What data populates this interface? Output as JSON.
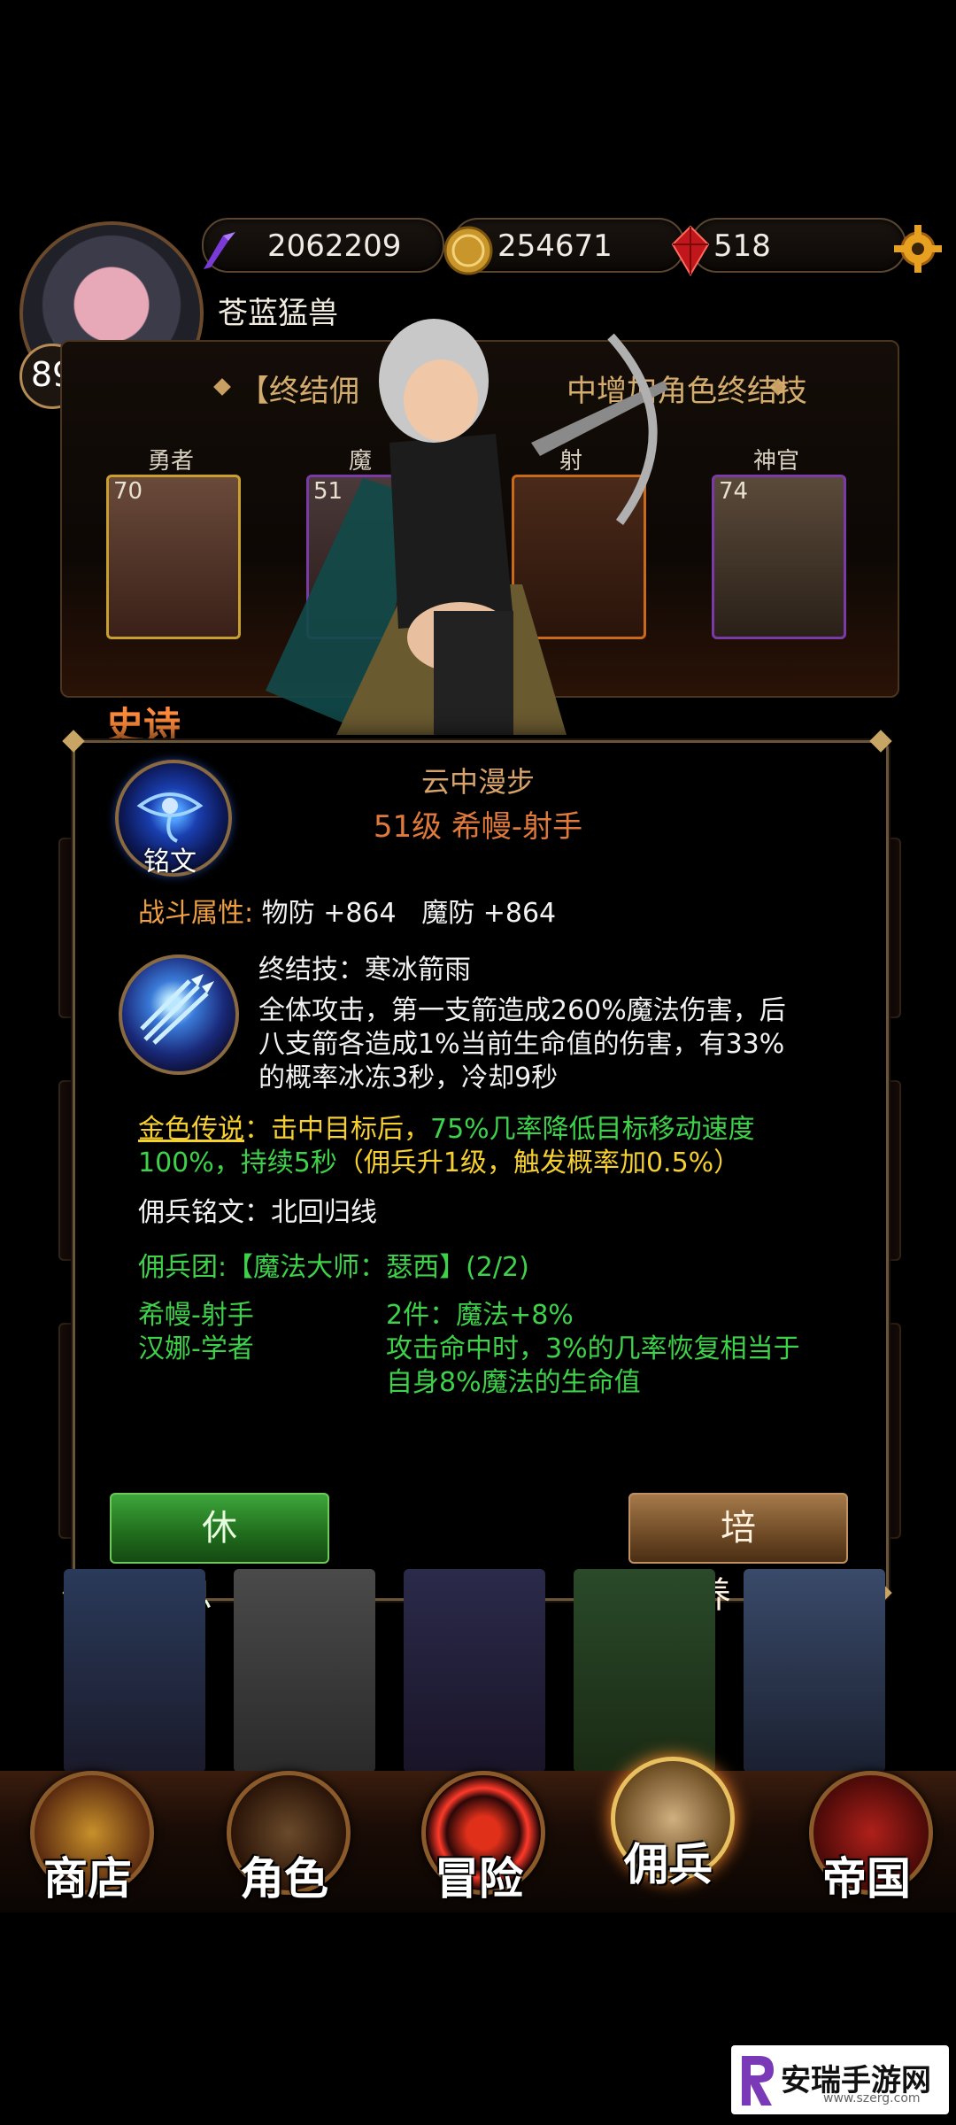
{
  "resources": {
    "soul": "2062209",
    "gold": "254671",
    "gems": "518"
  },
  "player": {
    "level": "89",
    "name": "苍蓝猛兽"
  },
  "formation": {
    "banner_left": "【终结佣",
    "banner_right": "中增加角色终结技",
    "slots": [
      {
        "class": "勇者",
        "level": "70"
      },
      {
        "class": "魔",
        "level": "51"
      },
      {
        "class": "射",
        "level": ""
      },
      {
        "class": "神官",
        "level": "74"
      }
    ]
  },
  "rarity_label": "史诗",
  "dialog": {
    "skill_name": "云中漫步",
    "unit_title": "51级 希幔-射手",
    "rune_label": "铭文",
    "combat_attr_label": "战斗属性:",
    "combat_attr_value": "物防 +864   魔防 +864",
    "ult_title": "终结技：寒冰箭雨",
    "ult_desc_1": "全体攻击，第一支箭造成260%魔法伤害，后",
    "ult_desc_2": "八支箭各造成1%当前生命值的伤害，有33%",
    "ult_desc_3": "的概率冰冻3秒，冷却9秒",
    "legend_label": "金色传说",
    "legend_mid": "：击中目标后，",
    "legend_green": "75%几率降低目标移动速度",
    "legend_line2_green": "100%，持续5秒",
    "legend_line2_white": "（佣兵升1级，触发概率加0.5%）",
    "inscription": "佣兵铭文：北回归线",
    "regiment": "佣兵团:【魔法大师：瑟西】(2/2)",
    "member_1": "希幔-射手",
    "member_2": "汉娜-学者",
    "bonus_1": "2件：魔法+8%",
    "bonus_2a": "攻击命中时，3%的几率恢复相当于",
    "bonus_2b": "自身8%魔法的生命值",
    "btn_rest": "休息",
    "btn_train": "培养"
  },
  "nav": {
    "shop": "商店",
    "character": "角色",
    "adventure": "冒险",
    "mercenary": "佣兵",
    "empire": "帝国"
  },
  "watermark": {
    "name": "安瑞手游网",
    "url": "www.szerg.com"
  }
}
